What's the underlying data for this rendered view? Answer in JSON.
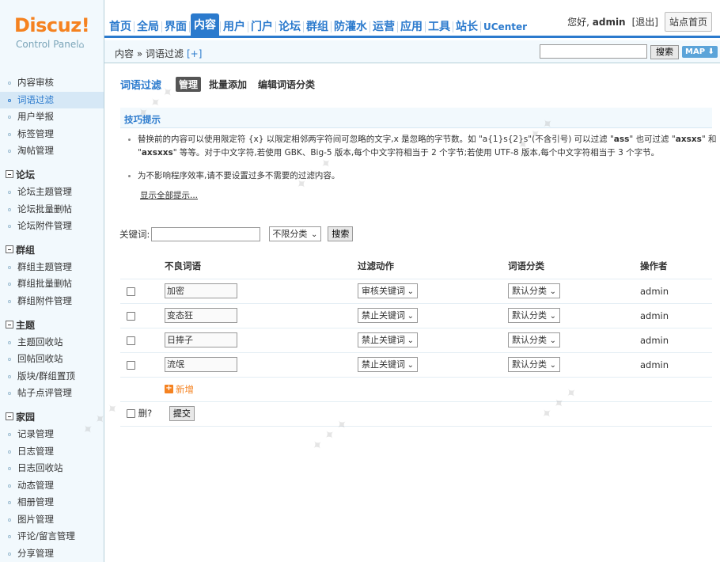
{
  "logo": {
    "brand": "Discuz!",
    "subtitle": "Control Panel"
  },
  "nav": {
    "items": [
      "首页",
      "全局",
      "界面",
      "内容",
      "用户",
      "门户",
      "论坛",
      "群组",
      "防灌水",
      "运营",
      "应用",
      "工具",
      "站长",
      "UCenter"
    ],
    "active": "内容"
  },
  "userbar": {
    "greeting": "您好,",
    "username": "admin",
    "logout": "[退出]",
    "site_home": "站点首页"
  },
  "subbar": {
    "breadcrumb": "内容 » 词语过滤",
    "add": "[+]",
    "search_button": "搜索",
    "map_button": "MAP"
  },
  "sidebar": {
    "top_items": [
      "内容审核",
      "词语过滤",
      "用户举报",
      "标签管理",
      "淘帖管理"
    ],
    "groups": [
      {
        "title": "论坛",
        "items": [
          "论坛主题管理",
          "论坛批量删帖",
          "论坛附件管理"
        ]
      },
      {
        "title": "群组",
        "items": [
          "群组主题管理",
          "群组批量删帖",
          "群组附件管理"
        ]
      },
      {
        "title": "主题",
        "items": [
          "主题回收站",
          "回帖回收站",
          "版块/群组置顶",
          "帖子点评管理"
        ]
      },
      {
        "title": "家园",
        "items": [
          "记录管理",
          "日志管理",
          "日志回收站",
          "动态管理",
          "相册管理",
          "图片管理",
          "评论/留言管理",
          "分享管理"
        ]
      }
    ]
  },
  "main": {
    "title": "词语过滤",
    "tabs": [
      "管理",
      "批量添加",
      "编辑词语分类"
    ],
    "tips_title": "技巧提示",
    "tip1_a": "替换前的内容可以使用限定符 {x} 以限定相邻两字符间可忽略的文字,x 是忽略的字节数。如 \"a{1}s{2}s\"(不含引号) 可以过滤 \"",
    "tip1_b1": "ass",
    "tip1_c": "\" 也可过滤 \"",
    "tip1_b2": "axsxs",
    "tip1_d": "\" 和 \"",
    "tip1_b3": "axsxxs",
    "tip1_e": "\" 等等。对于中文字符,若使用 GBK、Big-5 版本,每个中文字符相当于 2 个字节;若使用 UTF-8 版本,每个中文字符相当于 3 个字节。",
    "tip2": "为不影响程序效率,请不要设置过多不需要的过滤内容。",
    "show_all": "显示全部提示...",
    "keyword_label": "关键词:",
    "category_select": "不限分类",
    "search_button": "搜索",
    "table": {
      "headers": [
        "不良词语",
        "过滤动作",
        "词语分类",
        "操作者"
      ],
      "rows": [
        {
          "word": "加密",
          "action": "审核关键词",
          "category": "默认分类",
          "operator": "admin"
        },
        {
          "word": "变态狂",
          "action": "禁止关键词",
          "category": "默认分类",
          "operator": "admin"
        },
        {
          "word": "日捧子",
          "action": "禁止关键词",
          "category": "默认分类",
          "operator": "admin"
        },
        {
          "word": "流氓",
          "action": "禁止关键词",
          "category": "默认分类",
          "operator": "admin"
        }
      ],
      "add_label": "新增",
      "delete_label": "删?",
      "submit_label": "提交"
    }
  }
}
